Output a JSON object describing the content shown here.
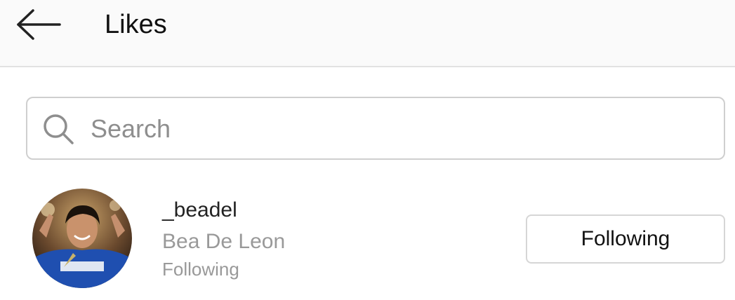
{
  "header": {
    "back_icon": "arrow-left-icon",
    "title": "Likes"
  },
  "search": {
    "icon": "search-icon",
    "placeholder": "Search",
    "value": ""
  },
  "likes": [
    {
      "username": "_beadel",
      "full_name": "Bea De Leon",
      "relationship": "Following",
      "button_label": "Following"
    }
  ],
  "colors": {
    "header_bg": "#fafafa",
    "secondary_text": "#999999",
    "border": "#d6d6d6"
  }
}
